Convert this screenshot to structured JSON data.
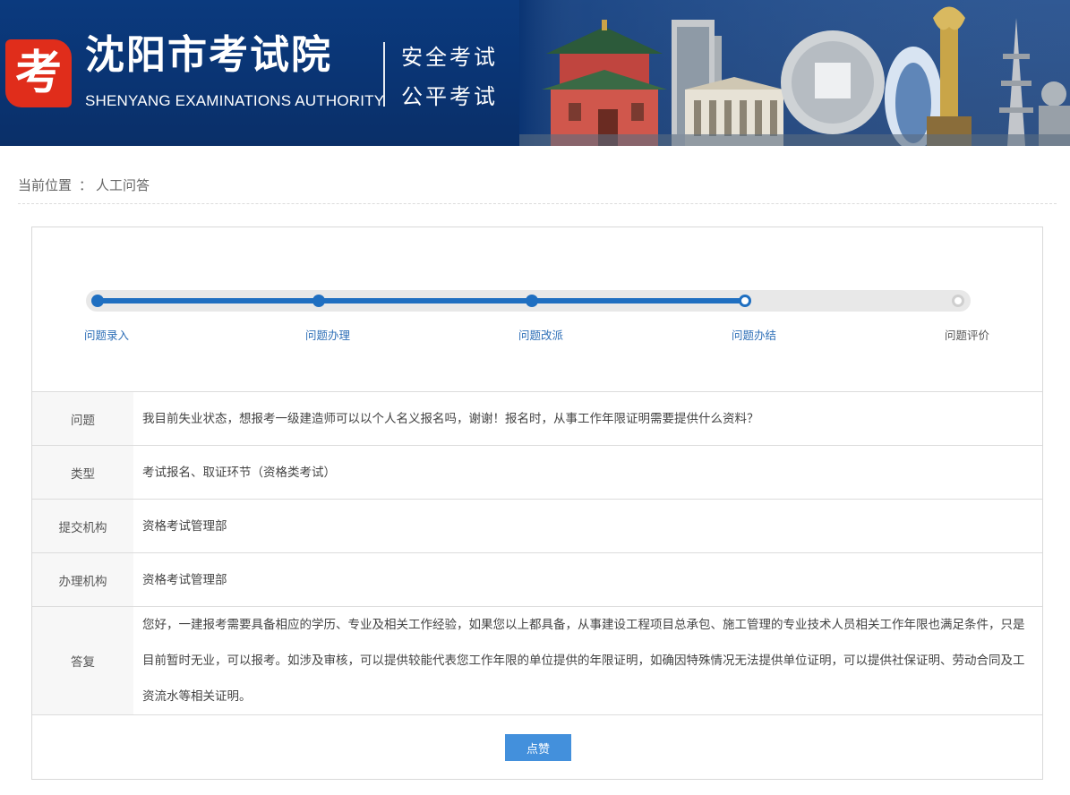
{
  "header": {
    "logo_glyph": "考",
    "org_name": "沈阳市考试院",
    "org_name_en": "SHENYANG EXAMINATIONS AUTHORITY",
    "slogan_1": "安全考试",
    "slogan_2": "公平考试",
    "brand_color": "#0b3a7e",
    "logo_color": "#e02d1b"
  },
  "breadcrumb": {
    "prefix": "当前位置",
    "separator": "：",
    "current": "人工问答"
  },
  "progress": {
    "steps": [
      {
        "label": "问题录入",
        "state": "done"
      },
      {
        "label": "问题办理",
        "state": "done"
      },
      {
        "label": "问题改派",
        "state": "done"
      },
      {
        "label": "问题办结",
        "state": "current"
      },
      {
        "label": "问题评价",
        "state": "pending"
      }
    ],
    "accent_color": "#1f6fc1"
  },
  "details": {
    "question_label": "问题",
    "question": "我目前失业状态，想报考一级建造师可以以个人名义报名吗，谢谢！报名时，从事工作年限证明需要提供什么资料？",
    "type_label": "类型",
    "type": "考试报名、取证环节（资格类考试）",
    "submit_org_label": "提交机构",
    "submit_org": "资格考试管理部",
    "handle_org_label": "办理机构",
    "handle_org": "资格考试管理部",
    "answer_label": "答复",
    "answer": "您好，一建报考需要具备相应的学历、专业及相关工作经验，如果您以上都具备，从事建设工程项目总承包、施工管理的专业技术人员相关工作年限也满足条件，只是目前暂时无业，可以报考。如涉及审核，可以提供较能代表您工作年限的单位提供的年限证明，如确因特殊情况无法提供单位证明，可以提供社保证明、劳动合同及工资流水等相关证明。"
  },
  "actions": {
    "like_label": "点赞"
  }
}
